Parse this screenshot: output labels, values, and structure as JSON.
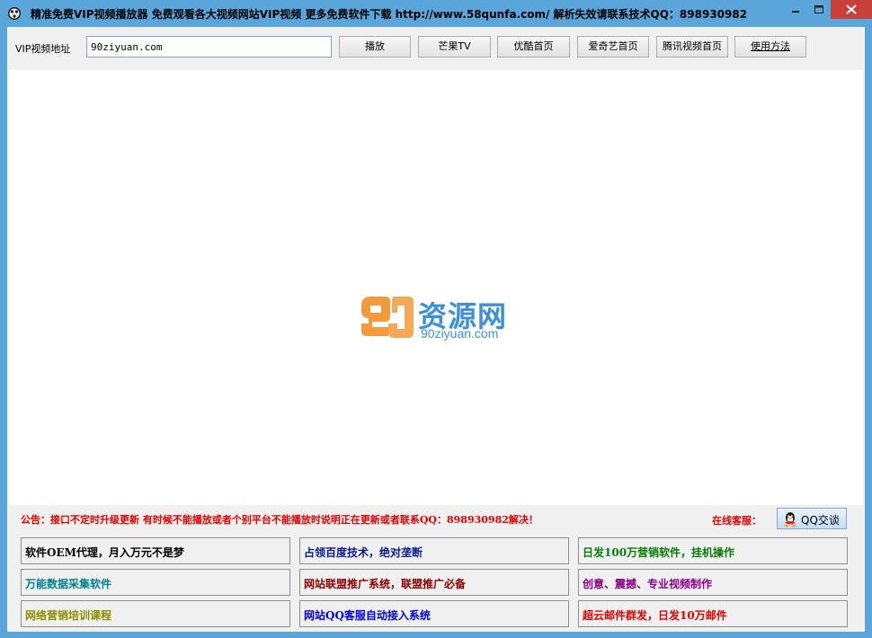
{
  "window": {
    "title": "精准免费VIP视频播放器 免费观看各大视频网站VIP视频 更多免费软件下载 http://www.58qunfa.com/ 解析失效请联系技术QQ：898930982"
  },
  "toolbar": {
    "url_label": "VIP视频地址",
    "url_value": "90ziyuan.com",
    "buttons": [
      {
        "label": "播放"
      },
      {
        "label": "芒果TV"
      },
      {
        "label": "优酷首页"
      },
      {
        "label": "爱奇艺首页"
      },
      {
        "label": "腾讯视频首页"
      },
      {
        "label": "使用方法"
      }
    ]
  },
  "viewer": {
    "logo_text": "资源网",
    "logo_number": "90",
    "logo_subtext": "90ziyuan.com"
  },
  "footer": {
    "notice": "公告：接口不定时升级更新 有时候不能播放或者个别平台不能播放时说明正在更新或者联系QQ：898930982解决！",
    "service_label": "在线客服：",
    "qq_button": "QQ交谈"
  },
  "promos": [
    {
      "label": "软件OEM代理，月入万元不是梦",
      "color": "#000000"
    },
    {
      "label": "占领百度技术，绝对垄断",
      "color": "#0a1a8c"
    },
    {
      "label": "日发100万营销软件，挂机操作",
      "color": "#0a7a0a"
    },
    {
      "label": "万能数据采集软件",
      "color": "#00808c"
    },
    {
      "label": "网站联盟推广系统，联盟推广必备",
      "color": "#8c0000"
    },
    {
      "label": "创意、震撼、专业视频制作",
      "color": "#8c008c"
    },
    {
      "label": "网络营销培训课程",
      "color": "#8c8c00"
    },
    {
      "label": "网站QQ客服自动接入系统",
      "color": "#0000e0"
    },
    {
      "label": "超云邮件群发，日发10万邮件",
      "color": "#e00000"
    }
  ],
  "colors": {
    "frame": "#5aa6db",
    "close_button": "#c7413a",
    "notice": "#e00000",
    "logo_blue": "#3f8fd7",
    "logo_orange": "#f29a3c"
  }
}
